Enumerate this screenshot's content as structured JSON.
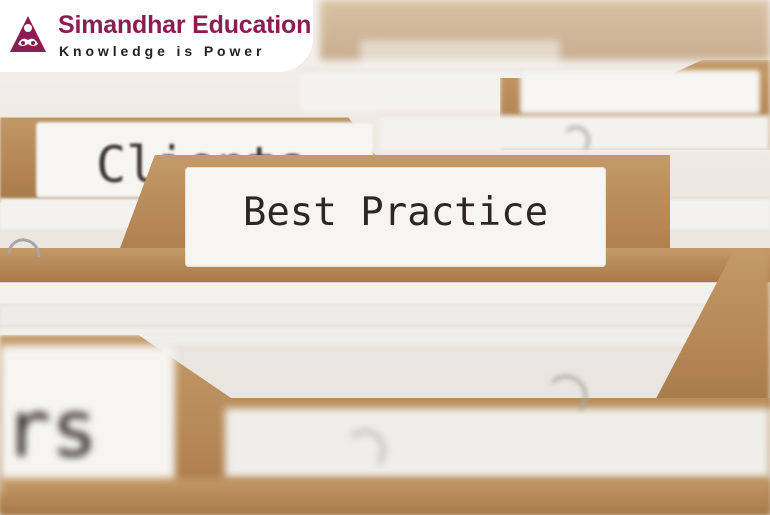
{
  "logo": {
    "brand_name": "Simandhar Education",
    "tagline": "Knowledge is Power",
    "brand_color": "#8b1d52",
    "icon": "meditation-figure-icon"
  },
  "photo": {
    "main_tab_label": "Best Practice",
    "back_tab_label": "Clients",
    "front_tab_label": "rs",
    "kraft_color": "#b48755",
    "label_color": "#f6f5f1"
  }
}
